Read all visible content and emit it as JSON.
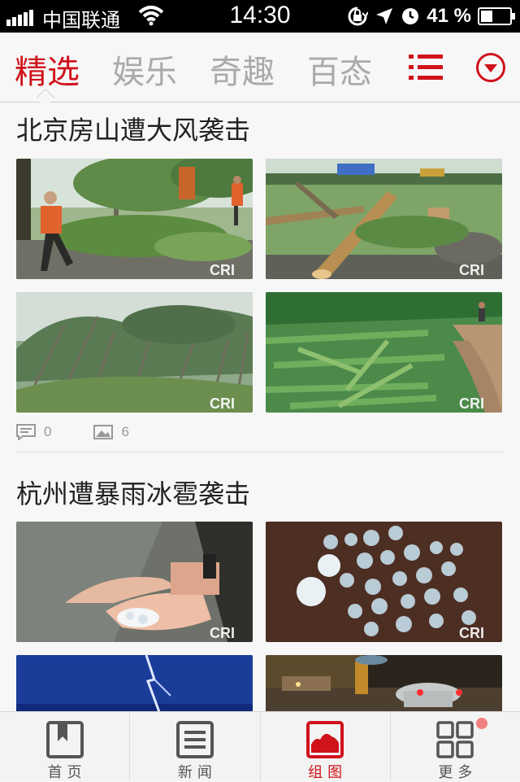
{
  "status_bar": {
    "carrier": "中国联通",
    "time": "14:30",
    "battery": "41 %",
    "battery_level": 0.41
  },
  "top_tabs": [
    {
      "label": "精选",
      "active": true
    },
    {
      "label": "娱乐",
      "active": false
    },
    {
      "label": "奇趣",
      "active": false
    },
    {
      "label": "百态",
      "active": false
    }
  ],
  "articles": [
    {
      "title": "北京房山遭大风袭击",
      "watermark": "CRI",
      "comments": "0",
      "images": "6"
    },
    {
      "title": "杭州遭暴雨冰雹袭击",
      "watermark": "CRI"
    }
  ],
  "tab_bar": [
    {
      "label": "首页",
      "icon": "bookmark-book-icon",
      "active": false
    },
    {
      "label": "新闻",
      "icon": "news-list-icon",
      "active": false
    },
    {
      "label": "组图",
      "icon": "photo-gallery-icon",
      "active": true
    },
    {
      "label": "更多",
      "icon": "grid-more-icon",
      "active": false
    }
  ],
  "colors": {
    "accent": "#d0121b",
    "inactive_tab": "#aaaaaa"
  }
}
